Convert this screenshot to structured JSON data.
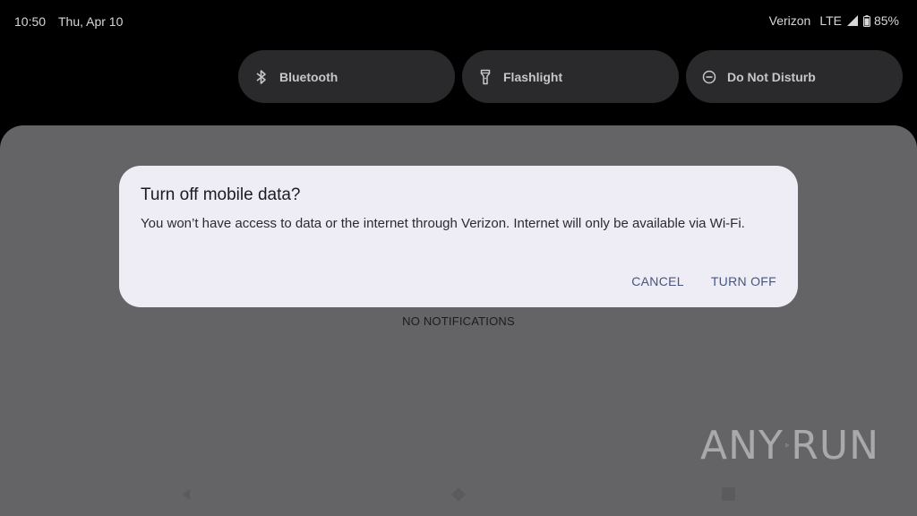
{
  "status_bar": {
    "time": "10:50",
    "date": "Thu, Apr 10",
    "carrier": "Verizon",
    "network": "LTE",
    "battery": "85%"
  },
  "quick_settings": {
    "tiles": [
      {
        "label": "Bluetooth",
        "icon": "bluetooth-icon"
      },
      {
        "label": "Flashlight",
        "icon": "flashlight-icon"
      },
      {
        "label": "Do Not Disturb",
        "icon": "do-not-disturb-icon"
      }
    ]
  },
  "shade": {
    "empty_label": "NO NOTIFICATIONS"
  },
  "dialog": {
    "title": "Turn off mobile data?",
    "message": "You won’t have access to data or the internet through Verizon. Internet will only be available via Wi-Fi.",
    "cancel_label": "CANCEL",
    "confirm_label": "TURN OFF"
  },
  "watermark": {
    "left_text": "ANY",
    "right_text": "RUN"
  },
  "colors": {
    "background": "#000000",
    "shade": "#646467",
    "dialog_bg": "#eeedf6",
    "accent": "#46557a",
    "tile_bg": "#2a2a2c"
  }
}
